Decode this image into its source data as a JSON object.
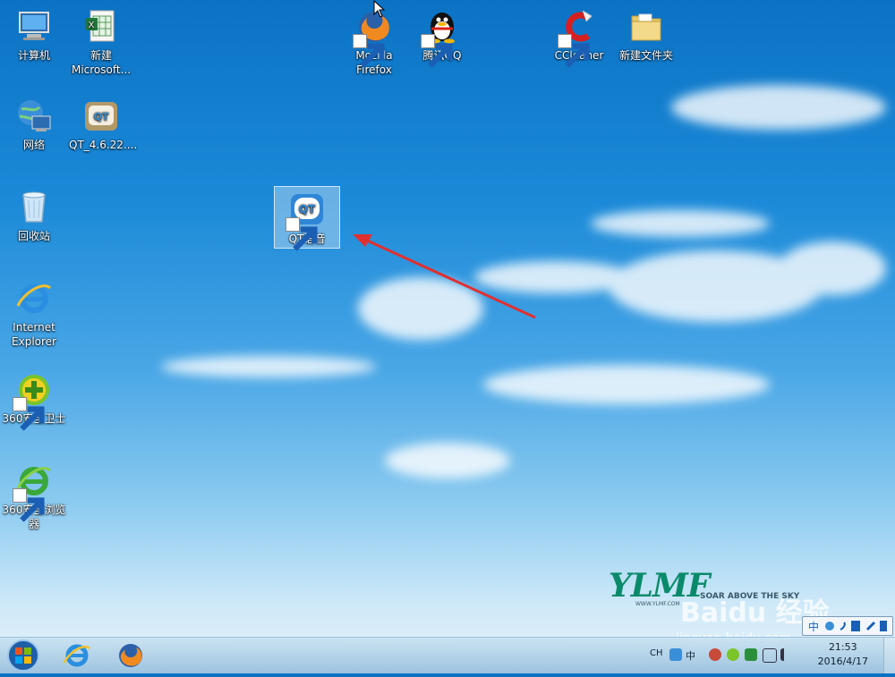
{
  "desktop": {
    "icons": [
      {
        "label": "计算机"
      },
      {
        "label": "新建\nMicrosoft..."
      },
      {
        "label": "网络"
      },
      {
        "label": "QT_4.6.22...."
      },
      {
        "label": "回收站"
      },
      {
        "label": "Internet\nExplorer"
      },
      {
        "label": "360安全卫士"
      },
      {
        "label": "360安全浏览\n器"
      },
      {
        "label": "Mozilla\nFirefox"
      },
      {
        "label": "腾讯QQ"
      },
      {
        "label": "CCleaner"
      },
      {
        "label": "新建文件夹"
      },
      {
        "label": "QT语音"
      }
    ],
    "selected_icon": "QT语音",
    "logo": {
      "text": "YLMF",
      "slogan": "SOAR ABOVE THE SKY",
      "url": "WWW.YLMF.COM"
    },
    "watermark": {
      "text": "Baidu 经验",
      "url": "jingyan.baidu.com"
    }
  },
  "taskbar": {
    "pinned": [
      "start-orb-icon",
      "internet-explorer-icon",
      "firefox-icon"
    ],
    "tray": {
      "lang": "CH",
      "time": "21:53",
      "date": "2016/4/17"
    }
  }
}
